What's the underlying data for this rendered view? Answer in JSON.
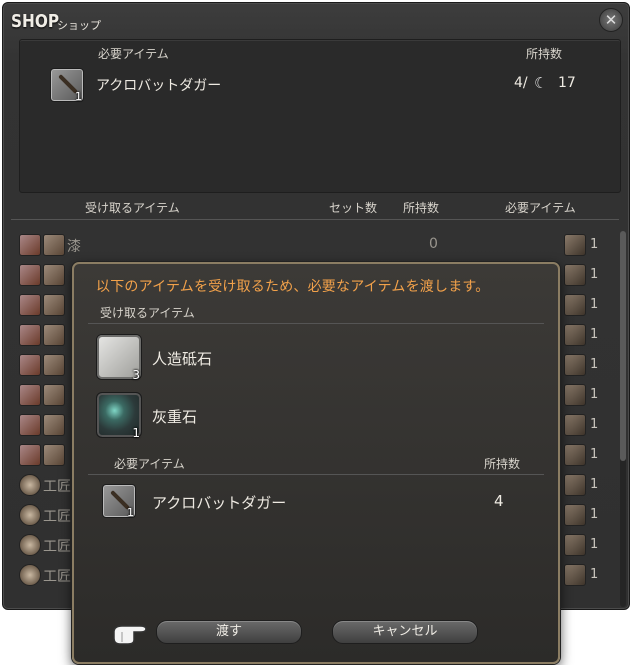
{
  "window": {
    "title": "SHOP",
    "subtitle": "ショップ"
  },
  "required_panel": {
    "header_item": "必要アイテム",
    "header_owned": "所持数",
    "item": {
      "name": "アクロバットダガー",
      "qty": "1",
      "owned": "4/",
      "currency_count": "17"
    }
  },
  "list_headers": {
    "receive": "受け取るアイテム",
    "sets": "セット数",
    "owned": "所持数",
    "required": "必要アイテム"
  },
  "rows": [
    {
      "label": "漆",
      "owned": "0",
      "req": "1"
    },
    {
      "label": "",
      "owned": "",
      "req": "1"
    },
    {
      "label": "",
      "owned": "",
      "req": "1"
    },
    {
      "label": "",
      "owned": "",
      "req": "1"
    },
    {
      "label": "",
      "owned": "",
      "req": "1"
    },
    {
      "label": "",
      "owned": "",
      "req": "1"
    },
    {
      "label": "",
      "owned": "",
      "req": "1"
    },
    {
      "label": "",
      "owned": "",
      "req": "1"
    },
    {
      "label": "工匠",
      "owned": "",
      "req": "1"
    },
    {
      "label": "工匠",
      "owned": "",
      "req": "1"
    },
    {
      "label": "工匠",
      "owned": "",
      "req": "1"
    },
    {
      "label": "工匠",
      "owned": "",
      "req": "1"
    }
  ],
  "dialog": {
    "message": "以下のアイテムを受け取るため、必要なアイテムを渡します。",
    "receive_header": "受け取るアイテム",
    "receive_items": [
      {
        "name": "人造砥石",
        "qty": "3"
      },
      {
        "name": "灰重石",
        "qty": "1"
      }
    ],
    "required_header": "必要アイテム",
    "owned_header": "所持数",
    "required_item": {
      "name": "アクロバットダガー",
      "qty": "1",
      "owned": "4"
    },
    "confirm_label": "渡す",
    "cancel_label": "キャンセル"
  },
  "colors": {
    "accent": "#f2a14a",
    "frame": "#8b7d63"
  }
}
